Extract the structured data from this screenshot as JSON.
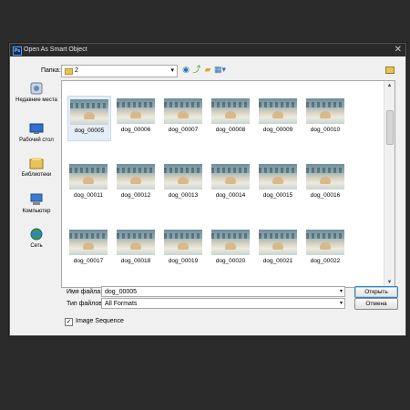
{
  "title": "Open As Smart Object",
  "folder": {
    "label": "Папка:",
    "current": "2"
  },
  "places": [
    {
      "label": "Недавние места",
      "icon": "recent-places-icon"
    },
    {
      "label": "Рабочий стол",
      "icon": "desktop-icon"
    },
    {
      "label": "Библиотеки",
      "icon": "libraries-icon"
    },
    {
      "label": "Компьютер",
      "icon": "computer-icon"
    },
    {
      "label": "Сеть",
      "icon": "network-icon"
    }
  ],
  "files": [
    "dog_00005",
    "dog_00006",
    "dog_00007",
    "dog_00008",
    "dog_00009",
    "dog_00010",
    "dog_00011",
    "dog_00012",
    "dog_00013",
    "dog_00014",
    "dog_00015",
    "dog_00016",
    "dog_00017",
    "dog_00018",
    "dog_00019",
    "dog_00020",
    "dog_00021",
    "dog_00022"
  ],
  "selected_file": "dog_00005",
  "filename": {
    "label": "Имя файла:",
    "value": "dog_00005"
  },
  "filetype": {
    "label": "Тип файлов:",
    "value": "All Formats"
  },
  "buttons": {
    "open": "Открыть",
    "cancel": "Отмена"
  },
  "image_sequence": {
    "label": "Image Sequence",
    "checked": true
  }
}
